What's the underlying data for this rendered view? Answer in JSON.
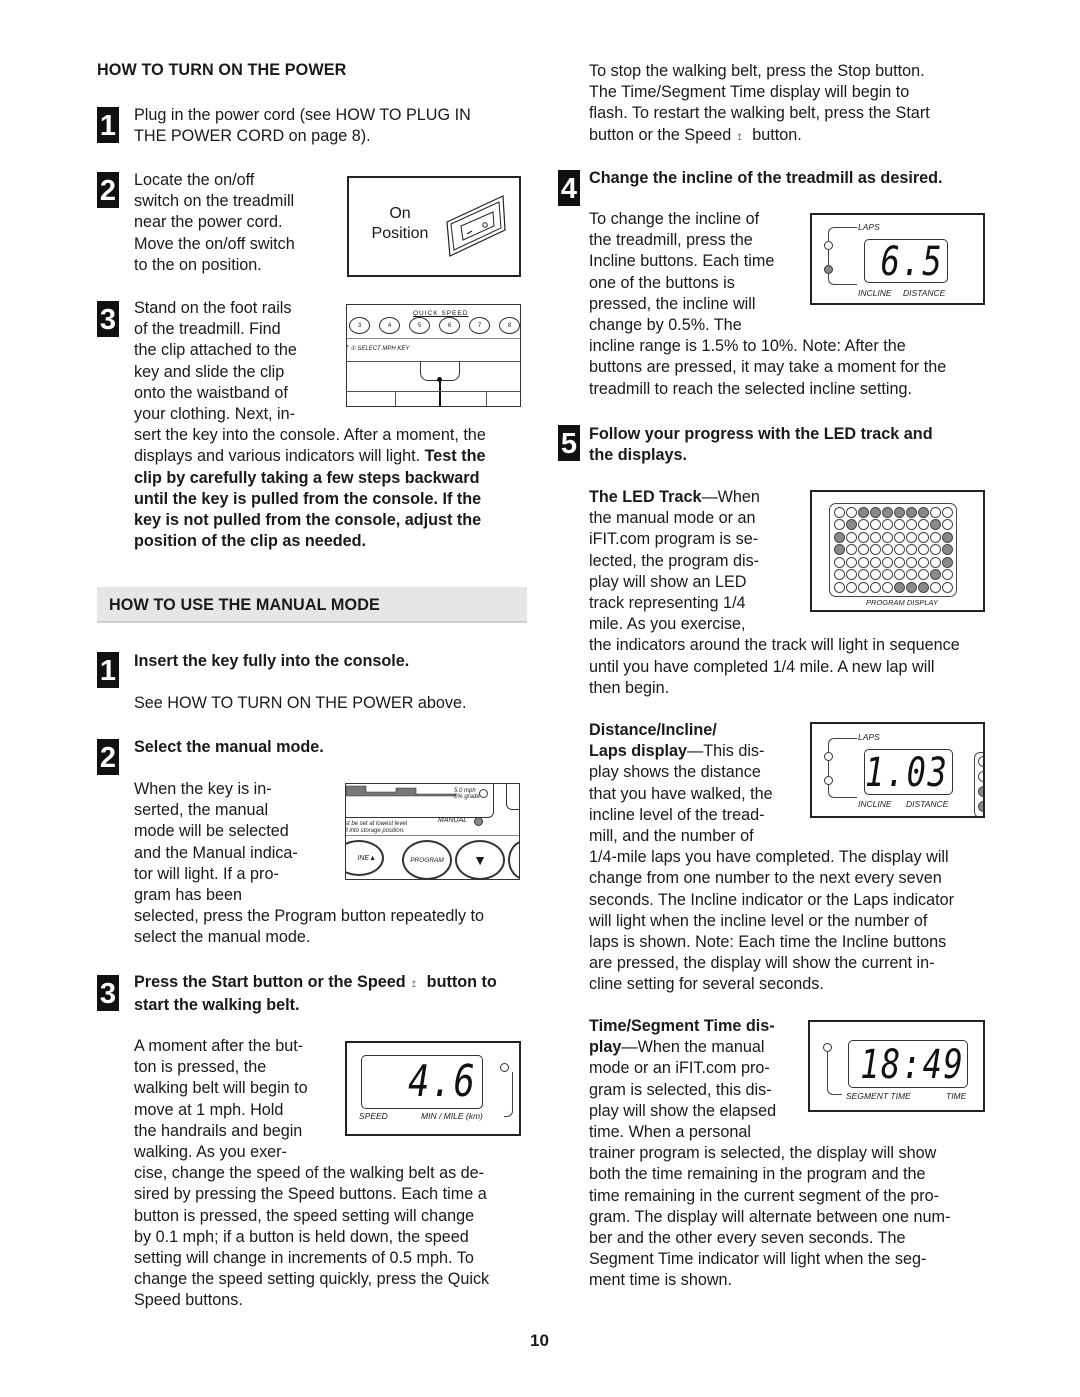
{
  "page_number": "10",
  "left": {
    "power_heading": "HOW TO TURN ON THE POWER",
    "power_steps": [
      {
        "num": "1",
        "lines": [
          "Plug in the power cord (see HOW TO PLUG IN",
          "THE POWER CORD on page 8)."
        ]
      },
      {
        "num": "2",
        "lines": [
          "Locate the on/off",
          "switch on the treadmill",
          "near the power cord.",
          "Move the on/off switch",
          "to the on position."
        ]
      },
      {
        "num": "3",
        "lines": [
          "Stand on the foot rails",
          "of the treadmill. Find",
          "the clip attached to the",
          "key and slide the clip",
          "onto the waistband of",
          "your clothing. Next, in-"
        ],
        "cont_normal": [
          "sert the key into the console. After a moment, the",
          "displays and various indicators will light. "
        ],
        "cont_bold_tail": "Test the",
        "cont_bold": [
          "clip by carefully taking a few steps backward",
          "until the key is pulled from the console. If the",
          "key is not pulled from the console, adjust the",
          "position of the clip as needed."
        ]
      }
    ],
    "switch_figure": {
      "label_line1": "On",
      "label_line2": "Position"
    },
    "key_figure": {
      "quick_speed": "QUICK SPEED",
      "buttons": [
        "3",
        "4",
        "5",
        "6",
        "7",
        "8"
      ],
      "select_text": "T ① SELECT MPH KEY"
    },
    "manual_heading": "HOW TO USE THE MANUAL MODE",
    "manual_steps": [
      {
        "num": "1",
        "title": "Insert the key fully into the console.",
        "body": "See HOW TO TURN ON THE POWER above."
      },
      {
        "num": "2",
        "title": "Select the manual mode.",
        "lines": [
          "When the key is in-",
          "serted, the manual",
          "mode will be selected",
          "and the Manual indica-",
          "tor will light. If a pro-",
          "gram has been"
        ],
        "cont": [
          "selected, press the Program button repeatedly to",
          "select the manual mode."
        ]
      },
      {
        "num": "3",
        "title_line1": "Press the Start button or the Speed s  button to",
        "title_line2": "start the walking belt.",
        "lines": [
          "A moment after the but-",
          "ton is pressed, the",
          "walking belt will begin to",
          "move at 1 mph. Hold",
          "the handrails and begin",
          "walking. As you exer-"
        ],
        "cont": [
          "cise, change the speed of the walking belt as de-",
          "sired by pressing the Speed buttons. Each time a",
          "button is pressed, the speed setting will change",
          "by 0.1 mph; if a button is held down, the speed",
          "setting will change in increments of 0.5 mph. To",
          "change the speed setting quickly, press the Quick",
          "Speed buttons."
        ]
      }
    ],
    "manual_figure": {
      "grade_text": "5.0 mph\n0% grade",
      "warning_line1": "st be set at lowest level",
      "warning_line2": "ll into storage position.",
      "manual_label": "MANUAL",
      "incline_label": "INE",
      "program_label": "PROGRAM"
    },
    "speed_display": {
      "value": "4.6",
      "label_left": "SPEED",
      "label_right": "MIN / MILE (km)"
    }
  },
  "right": {
    "stop_para": [
      "To stop the walking belt, press the Stop button.",
      "The Time/Segment Time display will begin to",
      "flash. To restart the walking belt, press the Start",
      "button or the Speed s  button."
    ],
    "step4": {
      "num": "4",
      "title": "Change the incline of the treadmill as desired.",
      "lines": [
        "To change the incline of",
        "the treadmill, press the",
        "Incline buttons. Each time",
        "one of the buttons is",
        "pressed, the incline will",
        "change by 0.5%. The"
      ],
      "cont": [
        "incline range is 1.5% to 10%. Note: After the",
        "buttons are pressed, it may take a moment for the",
        "treadmill to reach the selected incline setting."
      ]
    },
    "incline_display": {
      "value": "6.5",
      "laps_label": "LAPS",
      "incline_label": "INCLINE",
      "distance_label": "DISTANCE",
      "laps_on": false,
      "incline_on": true
    },
    "step5": {
      "num": "5",
      "title_line1": "Follow your progress with the LED track and",
      "title_line2": "the displays."
    },
    "led_track": {
      "term": "The LED Track",
      "dash": "—When",
      "lines": [
        "the manual mode or an",
        "iFIT.com program is se-",
        "lected, the program dis-",
        "play will show an LED",
        "track representing 1/4",
        "mile. As you exercise,"
      ],
      "cont": [
        "the indicators around the track will light in sequence",
        "until you have completed 1/4 mile. A new lap will",
        "then begin."
      ],
      "label": "PROGRAM DISPLAY",
      "grid": [
        [
          0,
          0,
          1,
          1,
          1,
          1,
          1,
          1,
          0,
          0
        ],
        [
          0,
          1,
          0,
          0,
          0,
          0,
          0,
          0,
          1,
          0
        ],
        [
          1,
          0,
          0,
          0,
          0,
          0,
          0,
          0,
          0,
          1
        ],
        [
          1,
          0,
          0,
          0,
          0,
          0,
          0,
          0,
          0,
          1
        ],
        [
          0,
          0,
          0,
          0,
          0,
          0,
          0,
          0,
          0,
          1
        ],
        [
          0,
          0,
          0,
          0,
          0,
          0,
          0,
          0,
          1,
          0
        ],
        [
          0,
          0,
          0,
          0,
          0,
          1,
          1,
          1,
          0,
          0
        ]
      ]
    },
    "distance": {
      "term_line1": "Distance/Incline/",
      "term_line2": "Laps display",
      "dash": "—This dis-",
      "lines": [
        "play shows the distance",
        "that you have walked, the",
        "incline level of the tread-",
        "mill, and the number of"
      ],
      "cont": [
        "1/4-mile laps you have completed. The display will",
        "change from one number to the next every seven",
        "seconds. The Incline indicator or the Laps indicator",
        "will light when the incline level or the number of",
        "laps is shown. Note: Each time the Incline buttons",
        "are pressed, the display will show the current in-",
        "cline setting for several seconds."
      ]
    },
    "distance_display": {
      "value": "1.03",
      "laps_label": "LAPS",
      "incline_label": "INCLINE",
      "distance_label": "DISTANCE",
      "laps_on": false,
      "incline_on": false
    },
    "time": {
      "term_line1": "Time/Segment Time dis-",
      "term_line2": "play",
      "dash": "—When the manual",
      "lines": [
        "mode or an iFIT.com pro-",
        "gram is selected, this dis-",
        "play will show the elapsed",
        "time. When a personal"
      ],
      "cont": [
        "trainer program is selected, the display will show",
        "both the time remaining in the program and the",
        "time remaining in the current segment of the pro-",
        "gram. The display will alternate between one num-",
        "ber and the other every seven seconds. The",
        "Segment Time indicator will light when the seg-",
        "ment time is shown."
      ]
    },
    "time_display": {
      "value": "18:49",
      "segment_label": "SEGMENT TIME",
      "time_label": "TIME"
    }
  }
}
